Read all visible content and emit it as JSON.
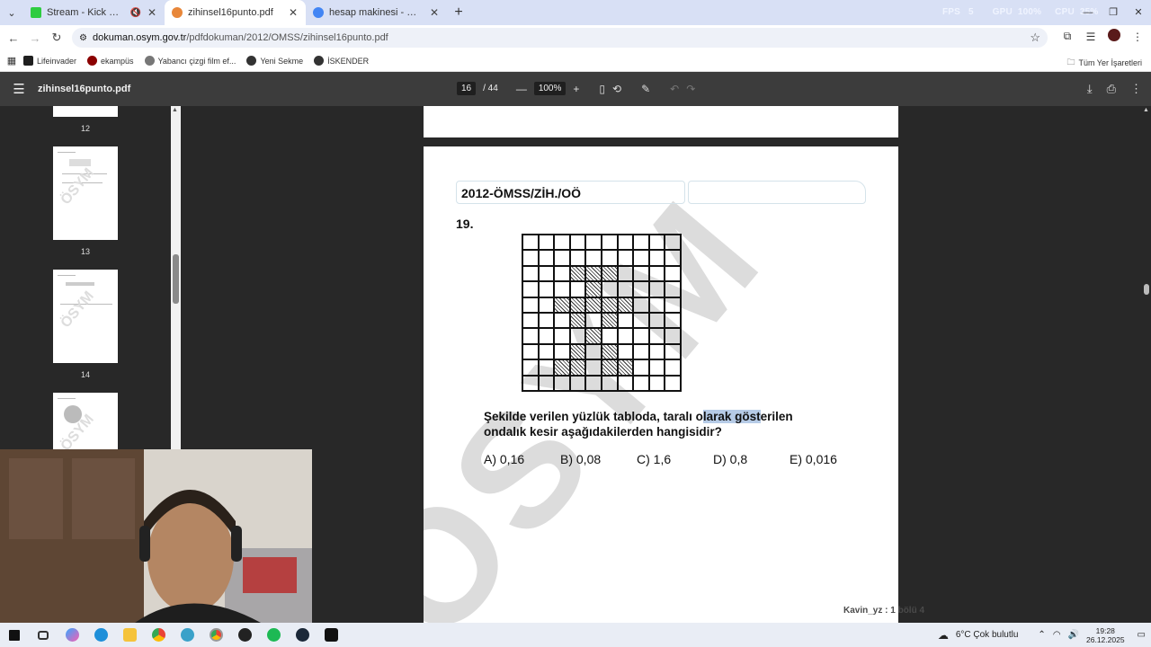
{
  "browser": {
    "tabs": [
      {
        "title": "Stream - Kick Dashboard",
        "active": false,
        "favicon_color": "#2ecc40"
      },
      {
        "title": "zihinsel16punto.pdf",
        "active": true,
        "favicon_color": "#e8873a"
      },
      {
        "title": "hesap makinesi - Google'da Ara",
        "active": false,
        "favicon_color": "#4285f4"
      }
    ],
    "hud": {
      "fps_label": "FPS",
      "fps_value": "5",
      "gpu_label": "GPU",
      "gpu_value": "100%",
      "cpu_label": "CPU",
      "cpu_value": "35%"
    },
    "url_domain": "dokuman.osym.gov.tr",
    "url_path": "/pdfdokuman/2012/OMSS/zihinsel16punto.pdf",
    "bookmarks": [
      {
        "label": "Lifeinvader",
        "icon": "lifeinvader-icon",
        "color": "#1f1f1f"
      },
      {
        "label": "ekampüs",
        "icon": "ekampus-icon",
        "color": "#8b0000"
      },
      {
        "label": "Yabancı çizgi film ef...",
        "icon": "globe-icon",
        "color": "#555555"
      },
      {
        "label": "Yeni Sekme",
        "icon": "chrome-icon",
        "color": "#333333"
      },
      {
        "label": "İSKENDER",
        "icon": "chrome-icon",
        "color": "#333333"
      }
    ],
    "bookmarks_right": "Tüm Yer İşaretleri"
  },
  "pdf": {
    "filename": "zihinsel16punto.pdf",
    "current_page": "16",
    "total_pages": "/ 44",
    "zoom": "100%",
    "thumbnails": [
      "12",
      "13",
      "14"
    ],
    "header_code": "2012-ÖMSS/ZİH./OÖ",
    "question_number": "19.",
    "question_text_pre": "Şekilde verilen yüzlük tabloda, taralı o",
    "question_text_hl": "larak göst",
    "question_text_post": "erilen ondalık kesir aşağıdakilerden hangisidir?",
    "options": [
      "A)  0,16",
      "B)  0,08",
      "C)  1,6",
      "D)  0,8",
      "E)  0,016"
    ],
    "watermark": "ÖSYM",
    "shaded_cells": [
      [
        2,
        3
      ],
      [
        2,
        4
      ],
      [
        2,
        5
      ],
      [
        3,
        4
      ],
      [
        4,
        2
      ],
      [
        4,
        3
      ],
      [
        4,
        4
      ],
      [
        4,
        5
      ],
      [
        4,
        6
      ],
      [
        5,
        3
      ],
      [
        5,
        5
      ],
      [
        6,
        4
      ],
      [
        7,
        3
      ],
      [
        7,
        5
      ],
      [
        8,
        2
      ],
      [
        8,
        3
      ],
      [
        8,
        5
      ],
      [
        8,
        6
      ]
    ]
  },
  "stream_overlay": "Kavin_yz : 1 bölü 4",
  "taskbar": {
    "weather": "6°C  Çok bulutlu",
    "time": "19:28",
    "date": "26.12.2025"
  }
}
